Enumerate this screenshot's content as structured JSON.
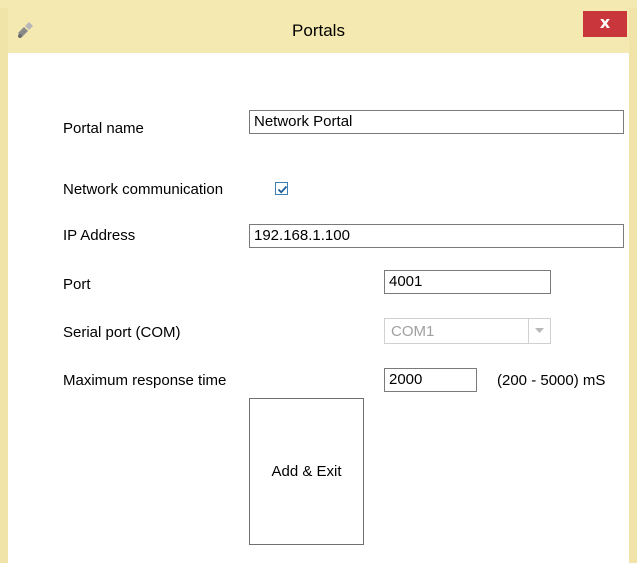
{
  "window": {
    "title": "Portals",
    "close_label": "x",
    "icon": "portal-app-icon"
  },
  "form": {
    "portal_name": {
      "label": "Portal name",
      "value": "Network Portal"
    },
    "network_communication": {
      "label": "Network communication",
      "checked": true
    },
    "ip_address": {
      "label": "IP Address",
      "value": "192.168.1.100"
    },
    "port": {
      "label": "Port",
      "value": "4001"
    },
    "serial_port": {
      "label": "Serial port (COM)",
      "value": "COM1",
      "enabled": false
    },
    "max_response_time": {
      "label": "Maximum response time",
      "value": "2000",
      "range_hint": "(200 - 5000) mS"
    }
  },
  "actions": {
    "add_exit_label": "Add & Exit"
  },
  "colors": {
    "frame": "#f4e9b0",
    "close_button": "#c9363b",
    "checkbox_accent": "#3c7fb1"
  }
}
